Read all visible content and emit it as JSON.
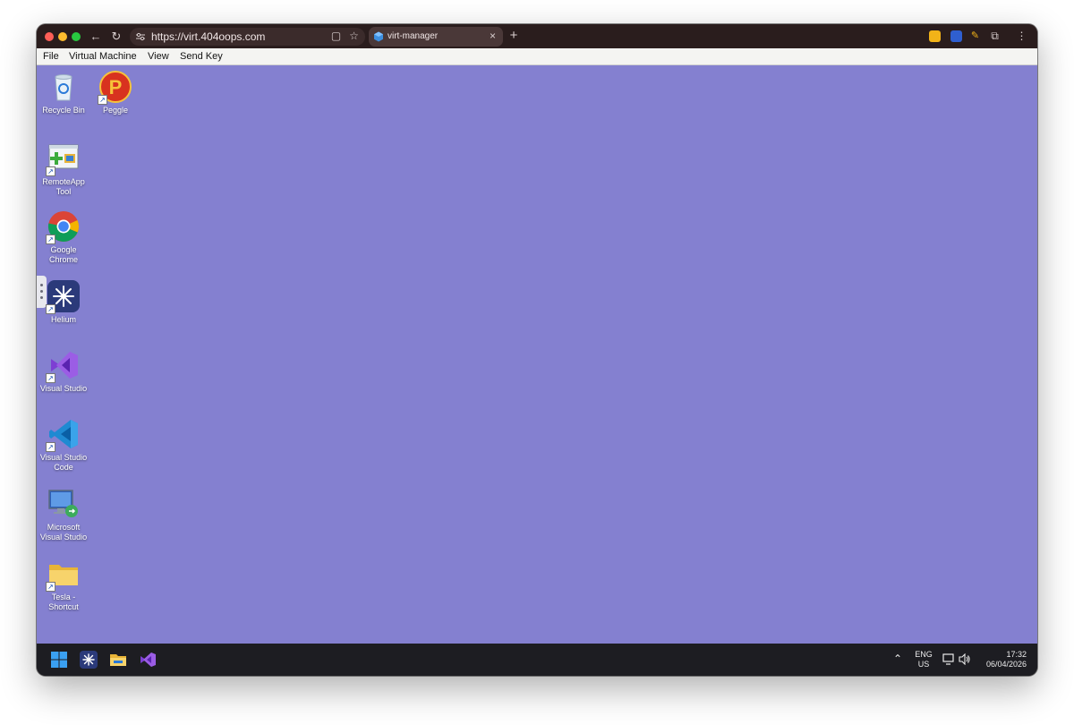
{
  "browser": {
    "url": "https://virt.404oops.com",
    "tab_title": "virt-manager",
    "new_tab": "+",
    "tab_close": "×"
  },
  "menubar": {
    "items": [
      "File",
      "Virtual Machine",
      "View",
      "Send Key"
    ]
  },
  "desktop": {
    "background": "#8480d0",
    "icons": [
      {
        "label": "Recycle Bin",
        "icon": "recycle-bin-icon"
      },
      {
        "label": "Peggle",
        "icon": "peggle-icon"
      },
      {
        "label": "RemoteApp Tool",
        "icon": "remoteapp-tool-icon"
      },
      {
        "label": "Google Chrome",
        "icon": "chrome-icon"
      },
      {
        "label": "Helium",
        "icon": "helium-icon"
      },
      {
        "label": "Visual Studio",
        "icon": "visual-studio-icon"
      },
      {
        "label": "Visual Studio Code",
        "icon": "vscode-icon"
      },
      {
        "label": "Microsoft Visual Studio",
        "icon": "remote-desktop-icon"
      },
      {
        "label": "Tesla - Shortcut",
        "icon": "folder-icon"
      }
    ]
  },
  "taskbar": {
    "apps": [
      "windows-start-icon",
      "helium-icon",
      "file-explorer-icon",
      "visual-studio-icon"
    ],
    "language": "ENG",
    "region": "US",
    "time": "17:32",
    "date": "06/04/2026"
  }
}
